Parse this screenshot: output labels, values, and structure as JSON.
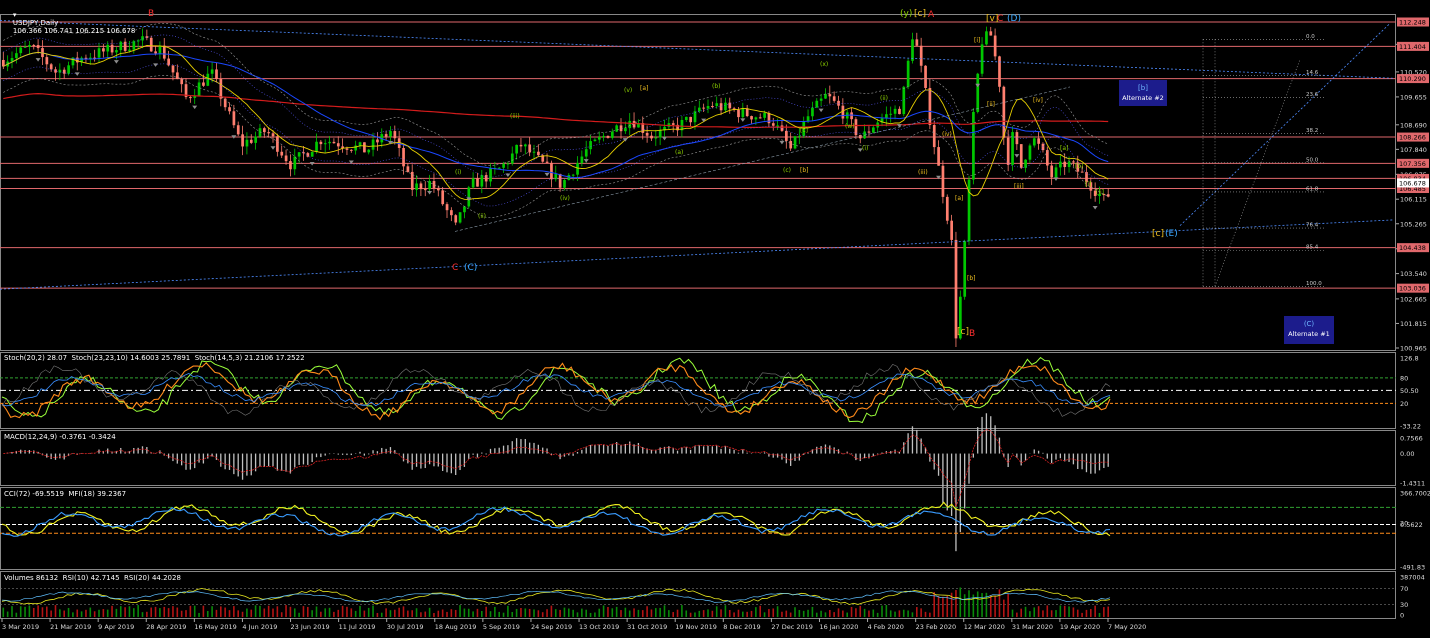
{
  "chart_data": [
    {
      "type": "line",
      "title": "USDJPY,Daily",
      "quote": "106.366 106.741 106.215 106.678",
      "x_ticks": [
        "3 Mar 2019",
        "21 Mar 2019",
        "9 Apr 2019",
        "28 Apr 2019",
        "16 May 2019",
        "4 Jun 2019",
        "23 Jun 2019",
        "11 Jul 2019",
        "30 Jul 2019",
        "18 Aug 2019",
        "5 Sep 2019",
        "24 Sep 2019",
        "13 Oct 2019",
        "31 Oct 2019",
        "19 Nov 2019",
        "8 Dec 2019",
        "27 Dec 2019",
        "16 Jan 2020",
        "4 Feb 2020",
        "23 Feb 2020",
        "12 Mar 2020",
        "31 Mar 2020",
        "19 Apr 2020",
        "7 May 2020"
      ],
      "y_ticks": [
        "111.475",
        "110.520",
        "109.655",
        "108.690",
        "107.840",
        "106.975",
        "106.115",
        "105.265",
        "104.400",
        "103.540",
        "102.665",
        "101.815",
        "100.965"
      ],
      "ylim": [
        100.965,
        112.248
      ],
      "horizontal_levels": [
        "112.248",
        "111.404",
        "110.290",
        "108.266",
        "107.356",
        "106.834",
        "106.485",
        "104.438",
        "103.036"
      ],
      "price_badges": [
        "106.678"
      ],
      "fib_levels": [
        "0.0",
        "14.6",
        "23.6",
        "38.2",
        "50.0",
        "61.8",
        "76.4",
        "85.4",
        "100.0"
      ],
      "wave_labels": {
        "top_left": "B",
        "low_1": "C",
        "low_1b": "(C)",
        "top_mid_1": "(y)",
        "top_mid_2": "[c]",
        "top_mid_3": "A",
        "top_right_1": "[v]",
        "top_right_2": "C",
        "top_right_3": "(D)",
        "bottom_1": "[c]",
        "bottom_2": "B",
        "proj_c": "[c]",
        "proj_e": "(E)"
      },
      "small_labels": [
        "(i)",
        "(ii)",
        "(iii)",
        "(iv)",
        "(v)",
        "[a]",
        "(a)",
        "(b)",
        "(c)",
        "[b]",
        "[c]",
        "(x)",
        "(w)",
        "(i)",
        "(ii)",
        "(iii)",
        "(iv)",
        "[a]",
        "[b]",
        "[i]",
        "[ii]",
        "[iii]",
        "[iv]",
        "[a]",
        "[b]",
        "[i]",
        "[ii]"
      ],
      "boxes": [
        {
          "line1": "[b]",
          "line2": "Alternate #2"
        },
        {
          "line1": "(C)",
          "line2": "Alternate #1"
        }
      ],
      "colors": {
        "up": "#00c800",
        "down": "#ff7f6f",
        "ma_red": "#d41c1c",
        "ma_blue": "#1a47ff",
        "ma_yellow": "#e8d000",
        "level": "#e0686c",
        "wave_red": "#ff3030",
        "wave_blue": "#3aa8ff",
        "wave_green": "#8fd400",
        "wave_yellow": "#f0c020",
        "box": "#1c1c8c"
      }
    },
    {
      "type": "line",
      "title": "Stoch(20,2) 28.07  Stoch(23,23,10) 14.6003 25.7891  Stoch(14,5,3) 21.2106 17.2522",
      "y_ticks": [
        "126.8",
        "80",
        "50.50",
        "20",
        "-33.22"
      ],
      "levels": [
        "80",
        "50.50",
        "20"
      ]
    },
    {
      "type": "bar",
      "title": "MACD(12,24,9) -0.3761 -0.3424",
      "y_ticks": [
        "0.7566",
        "0.00",
        "-1.4311"
      ]
    },
    {
      "type": "line",
      "title": "CCI(72) -69.5519  MFI(18) 39.2367",
      "y_ticks": [
        "366.7002",
        "0.5622",
        "20",
        "-491.83"
      ]
    },
    {
      "type": "line",
      "title": "Volumes 86132  RSI(10) 42.7145  RSI(20) 44.2028",
      "y_ticks": [
        "387004",
        "70",
        "30",
        "0"
      ]
    }
  ]
}
